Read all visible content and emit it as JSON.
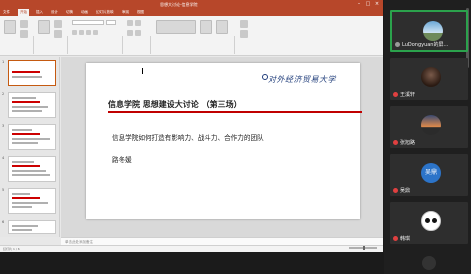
{
  "window": {
    "doc_title": "思想大讨论-信息学院",
    "colors": {
      "accent": "#b7472a",
      "slide_rule": "#c00000"
    }
  },
  "ribbon": {
    "tabs": [
      "文件",
      "开始",
      "插入",
      "设计",
      "切换",
      "动画",
      "幻灯片放映",
      "审阅",
      "视图"
    ],
    "active_tab": "开始"
  },
  "thumbnails": [
    "1",
    "2",
    "3",
    "4",
    "5",
    "6"
  ],
  "slide": {
    "title": "信息学院 思想建设大讨论 （第三场）",
    "subtitle": "信息学院如何打造有影响力、战斗力、合作力的团队",
    "author": "路冬媛",
    "logo_text": "对外经济贸易大学"
  },
  "notes_placeholder": "单击此处添加备注",
  "status_text": "幻灯片 1 / 6",
  "participants": [
    {
      "name": "LuDongyuan的屏...",
      "avatar": "sky-photo",
      "muted": false,
      "active": true
    },
    {
      "name": "王溪轩",
      "avatar": "portrait-photo",
      "muted": true,
      "active": false
    },
    {
      "name": "张旭路",
      "avatar": "sunset-photo",
      "muted": true,
      "active": false
    },
    {
      "name": "吴鼎",
      "avatar_text": "吴鼎",
      "muted": true,
      "active": false
    },
    {
      "name": "韩琪",
      "avatar": "panda",
      "muted": true,
      "active": false
    }
  ]
}
